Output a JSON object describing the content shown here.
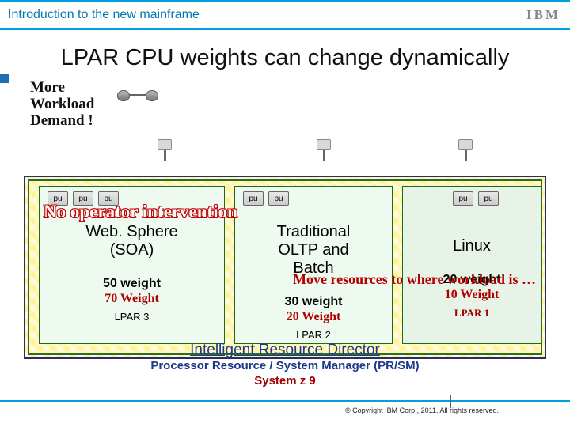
{
  "header": {
    "breadcrumb": "Introduction to the new mainframe",
    "logo_text": "IBM"
  },
  "page_title": "LPAR CPU weights can change dynamically",
  "demand_text": "More\nWorkload\nDemand !",
  "pu_label": "pu",
  "overlays": {
    "no_operator": "No operator intervention",
    "move_resources": "Move resources to where workload is …"
  },
  "lpars": [
    {
      "id": "lpar-3",
      "pu_count": 3,
      "title": "Web. Sphere\n(SOA)",
      "old_weight": "50 weight",
      "new_weight": "70 Weight",
      "label": "LPAR 3"
    },
    {
      "id": "lpar-2",
      "pu_count": 2,
      "title": "Traditional\nOLTP and\nBatch",
      "old_weight": "30 weight",
      "new_weight": "20 Weight",
      "label": "LPAR 2"
    },
    {
      "id": "lpar-1",
      "pu_count": 2,
      "title": "Linux",
      "old_weight": "20 weight",
      "new_weight": "10 Weight",
      "label": "LPAR 1"
    }
  ],
  "footer_lines": {
    "ird": "Intelligent Resource Director",
    "prsm": "Processor Resource / System Manager (PR/SM)",
    "systemz9": "System z 9"
  },
  "copyright": "© Copyright IBM Corp., 2011. All rights reserved."
}
